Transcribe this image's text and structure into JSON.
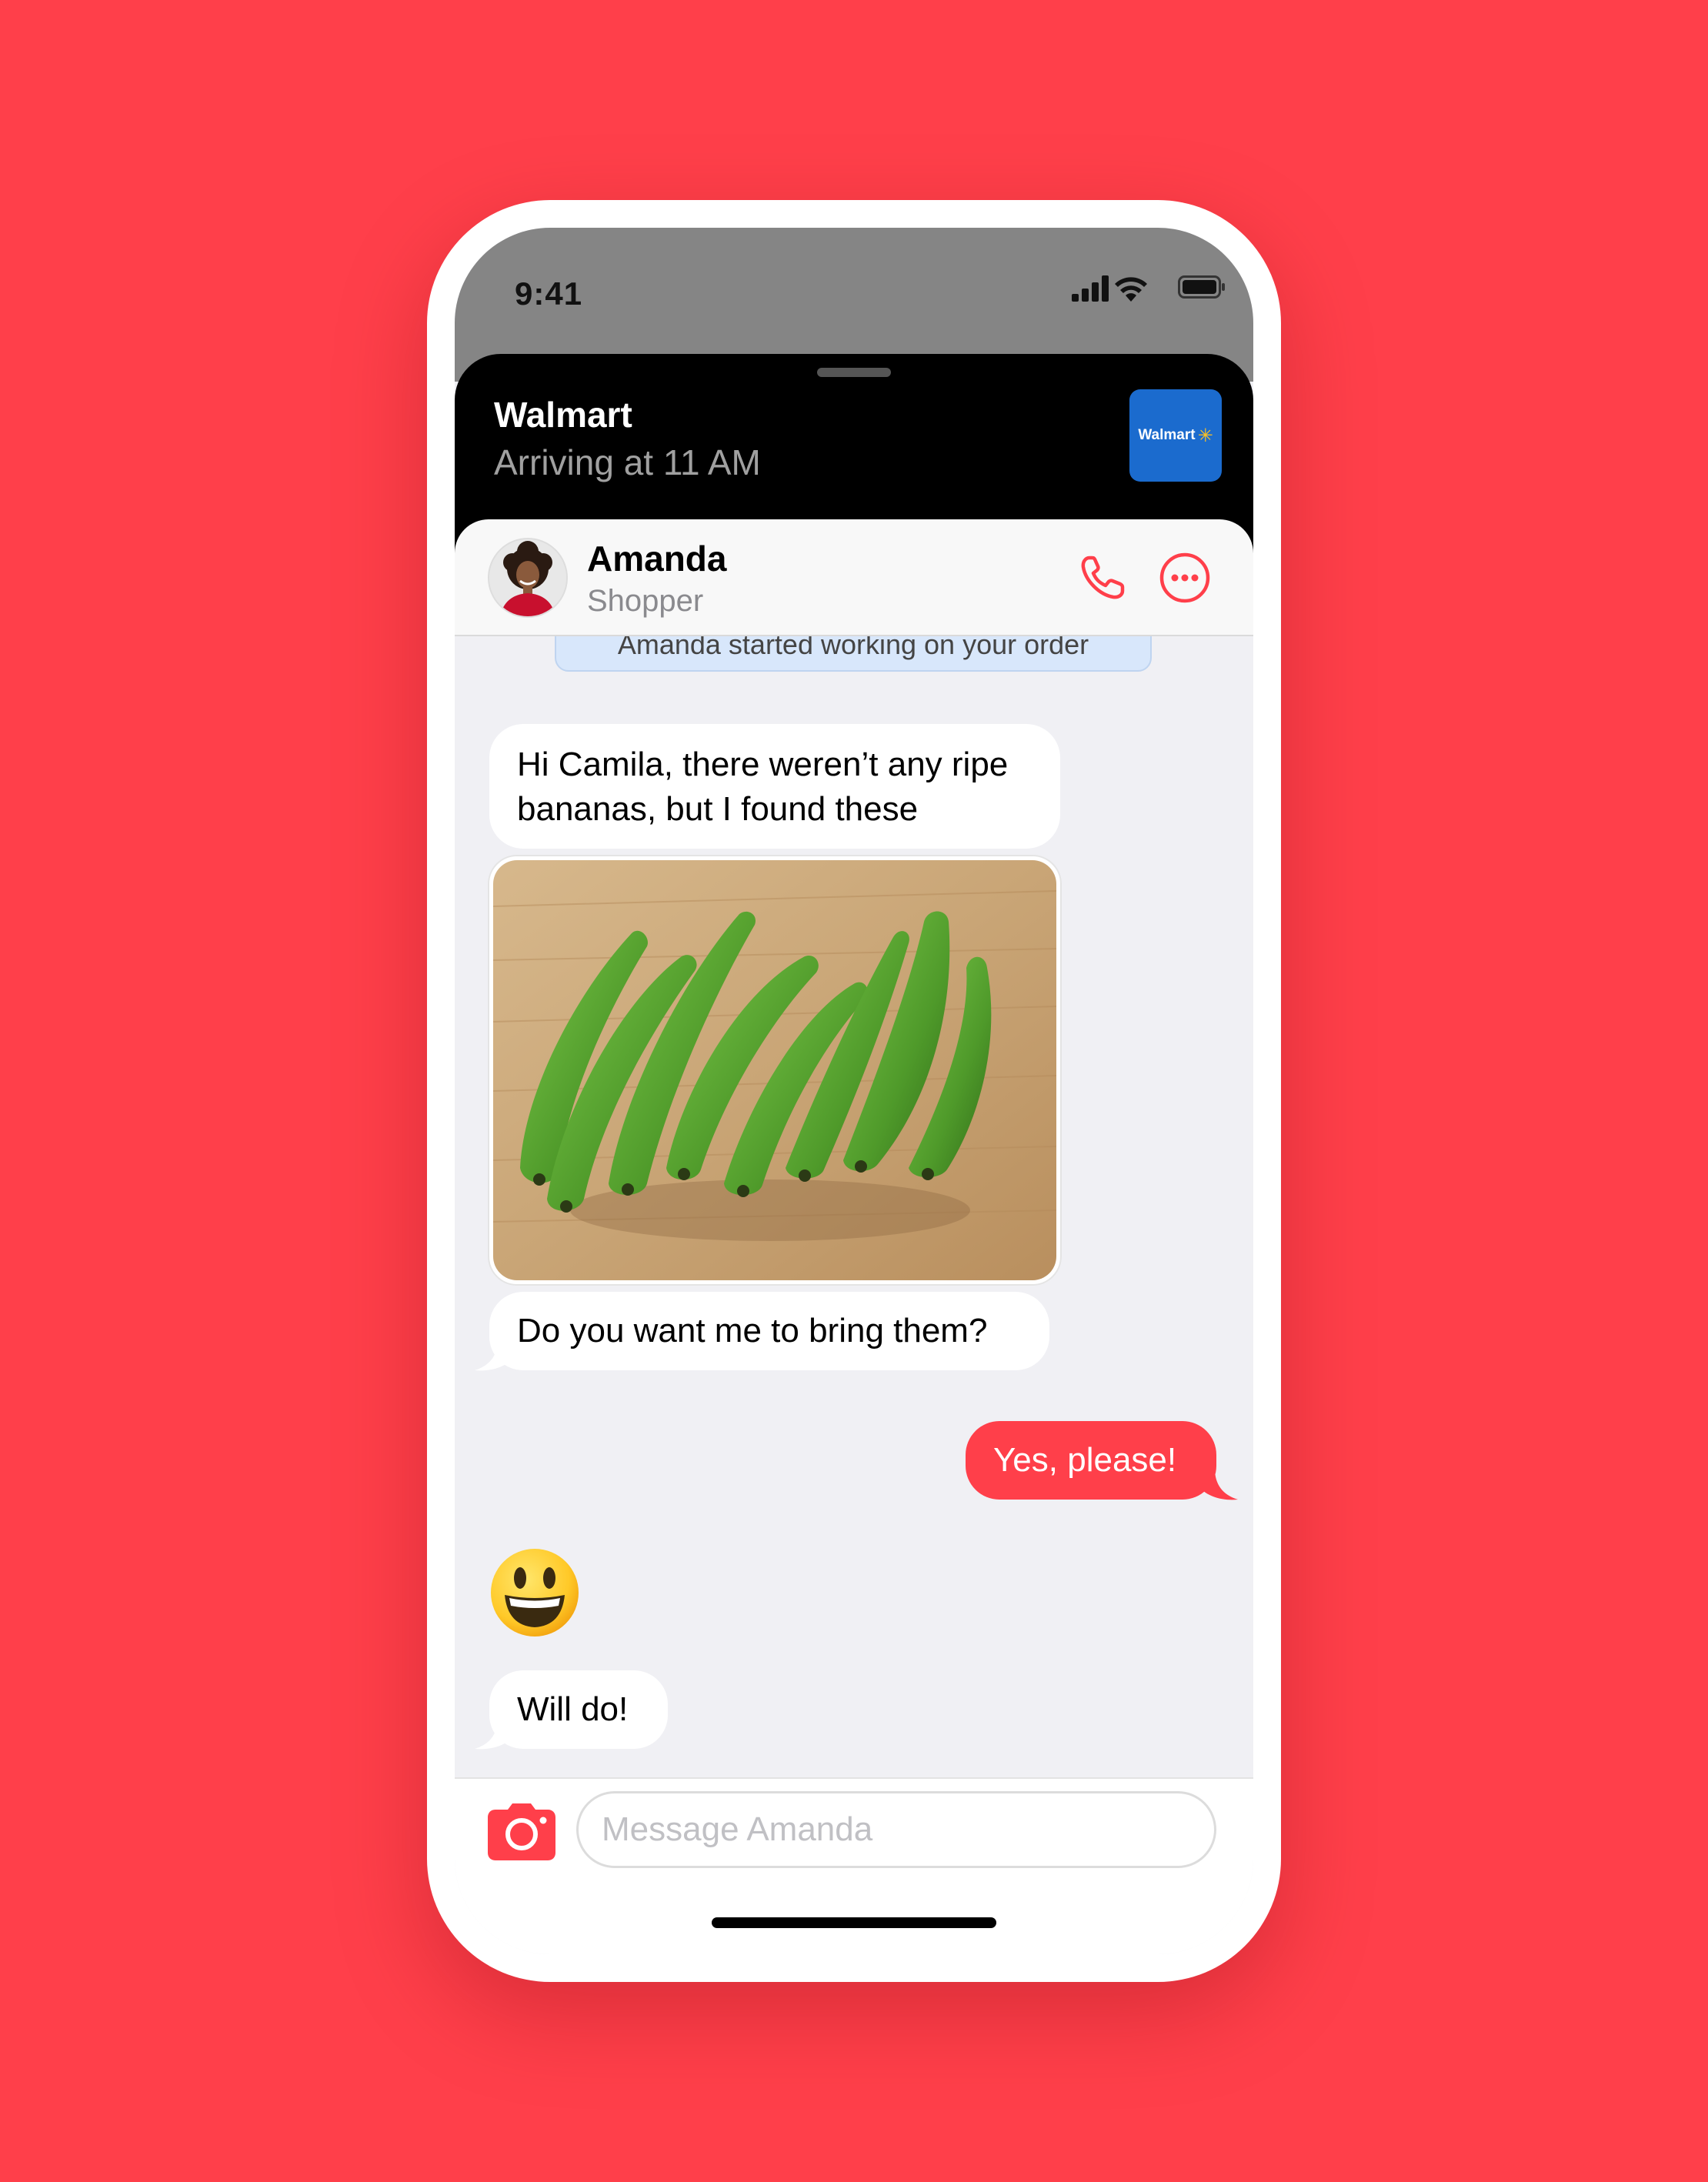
{
  "status_bar": {
    "time": "9:41"
  },
  "order": {
    "store": "Walmart",
    "arrival": "Arriving at 11 AM",
    "logo_text": "Walmart"
  },
  "contact": {
    "name": "Amanda",
    "role": "Shopper"
  },
  "chat": {
    "system_note": "Amanda started working on your order",
    "messages": [
      {
        "text": "Hi Camila, there weren’t any ripe bananas, but I found these"
      },
      {
        "text": "Do you want me to bring them?"
      },
      {
        "text": "Yes, please!"
      },
      {
        "text": "Will do!"
      }
    ]
  },
  "composer": {
    "placeholder": "Message Amanda"
  },
  "colors": {
    "background": "#FF3F4A",
    "accent": "#FF3F4A",
    "store_logo": "#1B6BCE"
  },
  "icons": [
    "signal-icon",
    "wifi-icon",
    "battery-icon",
    "phone-call-icon",
    "more-icon",
    "camera-icon",
    "smiley-emoji"
  ]
}
